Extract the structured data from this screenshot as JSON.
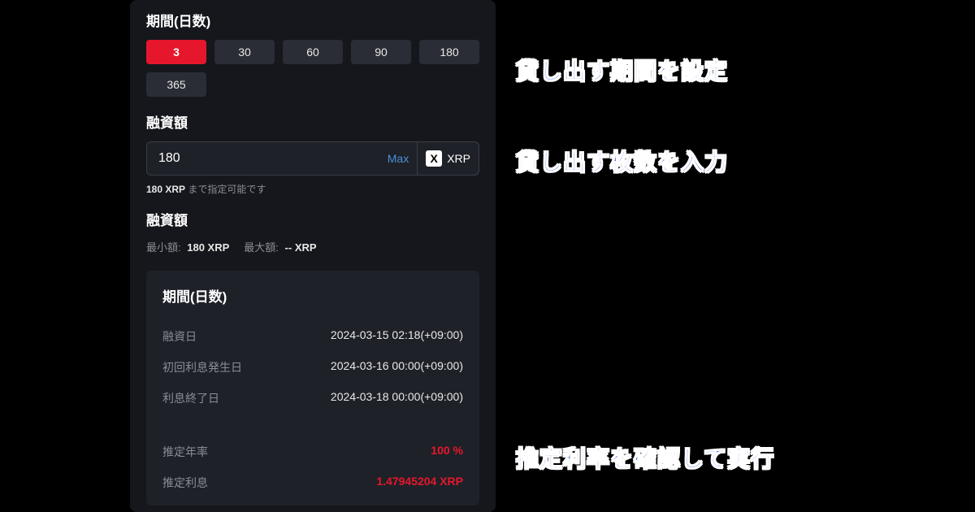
{
  "panel": {
    "period_title": "期間(日数)",
    "periods": [
      "3",
      "30",
      "60",
      "90",
      "180",
      "365"
    ],
    "active_period_index": 0,
    "amount_title": "融資額",
    "amount_value": "180",
    "max_label": "Max",
    "coin_symbol": "X",
    "coin_label": "XRP",
    "hint_strong": "180 XRP",
    "hint_rest": " まで指定可能です",
    "amount_title2": "融資額",
    "min_label": "最小額:",
    "min_value": "180 XRP",
    "max_label2": "最大額:",
    "max_value": "-- XRP"
  },
  "summary": {
    "title": "期間(日数)",
    "rows": [
      {
        "label": "融資日",
        "value": "2024-03-15 02:18(+09:00)"
      },
      {
        "label": "初回利息発生日",
        "value": "2024-03-16 00:00(+09:00)"
      },
      {
        "label": "利息終了日",
        "value": "2024-03-18 00:00(+09:00)"
      }
    ],
    "rate_label": "推定年率",
    "rate_value": "100 %",
    "interest_label": "推定利息",
    "interest_value": "1.47945204 XRP"
  },
  "annotations": {
    "a1": "貸し出す期間を設定",
    "a2": "貸し出す枚数を入力",
    "a3": "推定利率を確認して実行"
  }
}
